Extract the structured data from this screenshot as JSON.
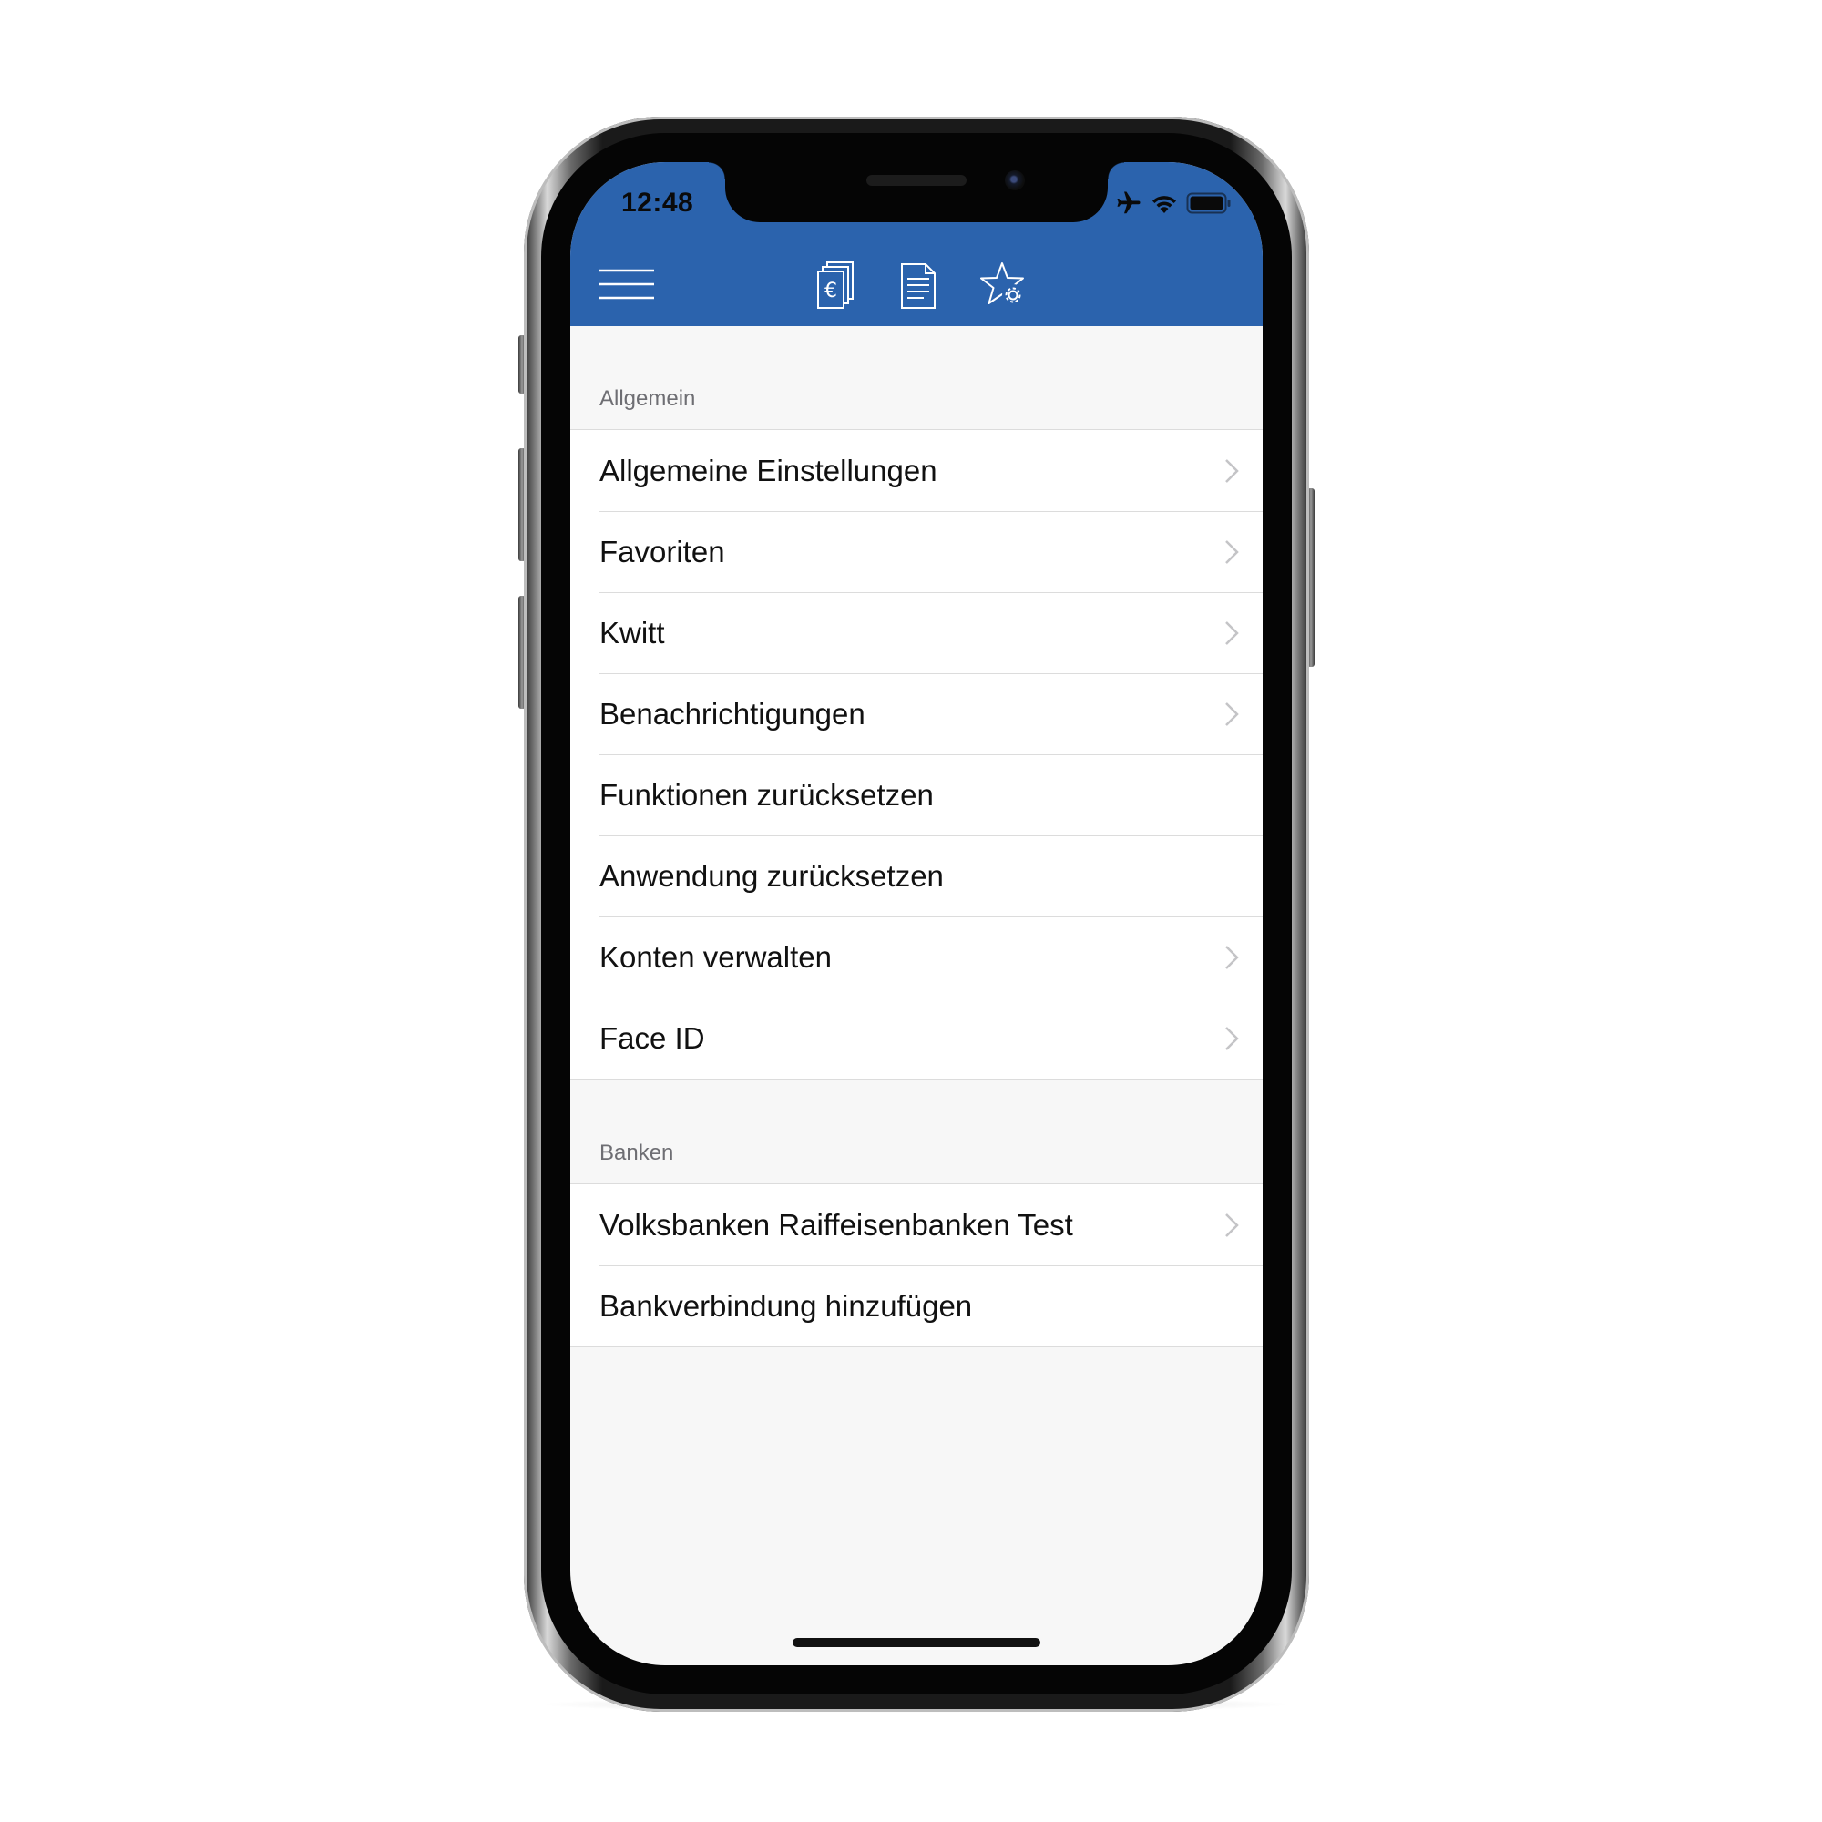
{
  "status_bar": {
    "time": "12:48",
    "icons": [
      "airplane-mode-icon",
      "wifi-icon",
      "battery-icon"
    ]
  },
  "toolbar": {
    "menu_icon": "hamburger-menu-icon",
    "tabs": [
      {
        "icon": "euro-documents-icon"
      },
      {
        "icon": "document-icon"
      },
      {
        "icon": "star-settings-icon",
        "active": true
      }
    ]
  },
  "colors": {
    "accent": "#2b63ad",
    "background": "#f7f7f7",
    "separator": "#dcdcdc"
  },
  "sections": [
    {
      "header": "Allgemein",
      "items": [
        {
          "label": "Allgemeine Einstellungen",
          "chevron": true
        },
        {
          "label": "Favoriten",
          "chevron": true
        },
        {
          "label": "Kwitt",
          "chevron": true
        },
        {
          "label": "Benachrichtigungen",
          "chevron": true
        },
        {
          "label": "Funktionen zurücksetzen",
          "chevron": false
        },
        {
          "label": "Anwendung zurücksetzen",
          "chevron": false
        },
        {
          "label": "Konten verwalten",
          "chevron": true
        },
        {
          "label": "Face ID",
          "chevron": true
        }
      ]
    },
    {
      "header": "Banken",
      "items": [
        {
          "label": "Volksbanken Raiffeisenbanken Test",
          "chevron": true
        },
        {
          "label": "Bankverbindung hinzufügen",
          "chevron": false
        }
      ]
    }
  ]
}
